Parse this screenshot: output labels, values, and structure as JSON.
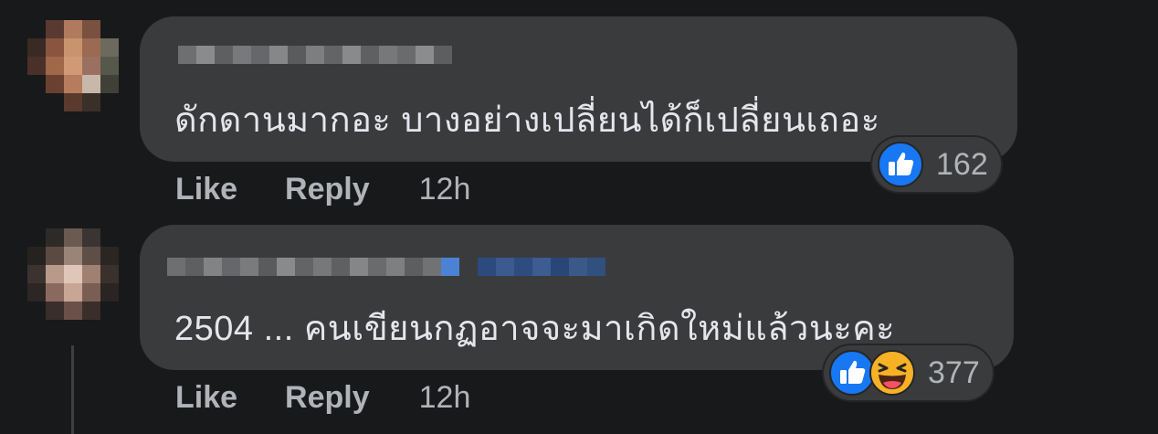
{
  "comments": [
    {
      "text": "ดักดานมากอะ บางอย่างเปลี่ยนได้ก็เปลี่ยนเถอะ",
      "actions": {
        "like": "Like",
        "reply": "Reply",
        "time": "12h"
      },
      "reactions": {
        "types": [
          "like-icon"
        ],
        "count": "162"
      }
    },
    {
      "text": "2504 ... คนเขียนกฏอาจจะมาเกิดใหม่แล้วนะคะ",
      "actions": {
        "like": "Like",
        "reply": "Reply",
        "time": "12h"
      },
      "reactions": {
        "types": [
          "like-icon",
          "haha-icon"
        ],
        "count": "377"
      }
    }
  ],
  "colors": {
    "background": "#18191a",
    "bubble": "#3a3b3c",
    "text": "#e4e6eb",
    "muted": "#b0b3b8",
    "like_blue": "#1877f2",
    "haha_yellow": "#f7b125"
  }
}
